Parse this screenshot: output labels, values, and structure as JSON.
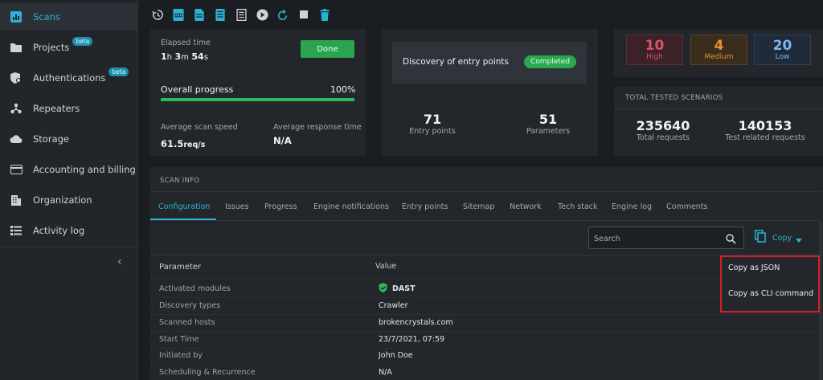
{
  "sidebar": {
    "items": [
      {
        "label": "Scans",
        "icon": "chart-bar-icon",
        "active": true,
        "badge": ""
      },
      {
        "label": "Projects",
        "icon": "folder-icon",
        "active": false,
        "badge": "beta"
      },
      {
        "label": "Authentications",
        "icon": "shield-gear-icon",
        "active": false,
        "badge": "beta"
      },
      {
        "label": "Repeaters",
        "icon": "repeater-icon",
        "active": false,
        "badge": ""
      },
      {
        "label": "Storage",
        "icon": "cloud-icon",
        "active": false,
        "badge": ""
      },
      {
        "label": "Accounting and billing",
        "icon": "credit-card-icon",
        "active": false,
        "badge": ""
      },
      {
        "label": "Organization",
        "icon": "building-icon",
        "active": false,
        "badge": ""
      },
      {
        "label": "Activity log",
        "icon": "list-icon",
        "active": false,
        "badge": ""
      }
    ],
    "collapse_glyph": "‹"
  },
  "toolbar": {
    "icons": [
      "history-icon",
      "pdf-icon",
      "document-icon",
      "report-icon",
      "table-report-icon",
      "play-icon",
      "retest-icon",
      "stop-icon",
      "delete-icon"
    ]
  },
  "progress_card": {
    "elapsed_label": "Elapsed time",
    "elapsed_h": "1",
    "elapsed_m": "3",
    "elapsed_s": "54",
    "unit_h": "h",
    "unit_m": "m",
    "unit_s": "s",
    "done_label": "Done",
    "overall_label": "Overall progress",
    "overall_value": "100%",
    "overall_fraction": 1.0,
    "speed_label": "Average scan speed",
    "speed_value": "61.5",
    "speed_unit": "req/s",
    "response_label": "Average response time",
    "response_value": "N/A"
  },
  "discovery_card": {
    "label": "Discovery of entry points",
    "status": "Completed",
    "entry_points_value": "71",
    "entry_points_label": "Entry points",
    "parameters_value": "51",
    "parameters_label": "Parameters"
  },
  "severity": [
    {
      "count": "10",
      "label": "High",
      "color": "#e0506b",
      "bg": "#3a2228",
      "border": "#5a2f39"
    },
    {
      "count": "4",
      "label": "Medium",
      "color": "#e8902f",
      "bg": "#3a2d1e",
      "border": "#5c4326"
    },
    {
      "count": "20",
      "label": "Low",
      "color": "#7db6f0",
      "bg": "#1f2b3a",
      "border": "#2d4158"
    }
  ],
  "scenarios": {
    "title": "TOTAL TESTED SCENARIOS",
    "total_value": "235640",
    "total_label": "Total requests",
    "related_value": "140153",
    "related_label": "Test related requests"
  },
  "scan_info": {
    "title": "SCAN INFO",
    "tabs": [
      "Configuration",
      "Issues",
      "Progress",
      "Engine notifications",
      "Entry points",
      "Sitemap",
      "Network",
      "Tech stack",
      "Engine log",
      "Comments"
    ],
    "search_placeholder": "Search",
    "copy_label": "Copy",
    "col_parameter": "Parameter",
    "col_value": "Value",
    "rows": [
      {
        "label": "Activated modules",
        "value": "DAST"
      },
      {
        "label": "Discovery types",
        "value": "Crawler"
      },
      {
        "label": "Scanned hosts",
        "value": "brokencrystals.com"
      },
      {
        "label": "Start Time",
        "value": "23/7/2021, 07:59"
      },
      {
        "label": "Initiated by",
        "value": "John Doe"
      },
      {
        "label": "Scheduling & Recurrence",
        "value": "N/A"
      }
    ]
  },
  "copy_menu": {
    "items": [
      "Copy as JSON",
      "Copy as CLI command"
    ]
  },
  "colors": {
    "accent": "#2ab3d4",
    "success": "#2aa44f",
    "highlight_border": "#d21f2a"
  }
}
